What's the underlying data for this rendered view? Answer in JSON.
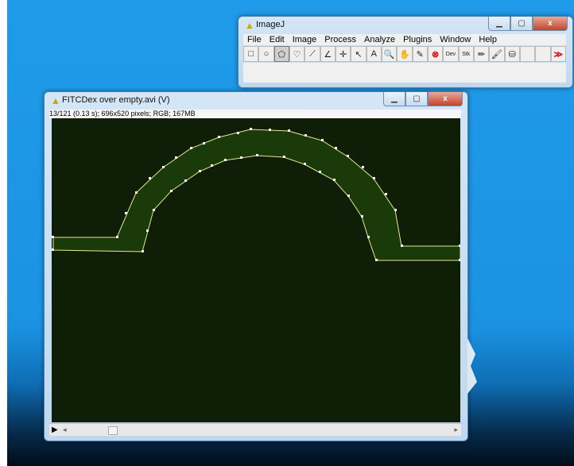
{
  "imagej_window": {
    "title": "ImageJ",
    "menu": [
      "File",
      "Edit",
      "Image",
      "Process",
      "Analyze",
      "Plugins",
      "Window",
      "Help"
    ],
    "tools": [
      {
        "name": "rectangle-tool-icon",
        "glyph": "□"
      },
      {
        "name": "oval-tool-icon",
        "glyph": "○"
      },
      {
        "name": "polygon-tool-icon",
        "glyph": "⬠"
      },
      {
        "name": "freehand-tool-icon",
        "glyph": "♡"
      },
      {
        "name": "line-tool-icon",
        "glyph": "⟋"
      },
      {
        "name": "angle-tool-icon",
        "glyph": "∠"
      },
      {
        "name": "point-tool-icon",
        "glyph": "✛"
      },
      {
        "name": "wand-tool-icon",
        "glyph": "↖"
      },
      {
        "name": "text-tool-icon",
        "glyph": "A"
      },
      {
        "name": "magnifier-tool-icon",
        "glyph": "🔍"
      },
      {
        "name": "hand-tool-icon",
        "glyph": "✋"
      },
      {
        "name": "color-picker-icon",
        "glyph": "✎"
      },
      {
        "name": "stop-icon",
        "glyph": "⊗"
      },
      {
        "name": "dev-menu-icon",
        "glyph": "Dev"
      },
      {
        "name": "stk-menu-icon",
        "glyph": "Stk"
      },
      {
        "name": "pencil-tool-icon",
        "glyph": "✏"
      },
      {
        "name": "brush-tool-icon",
        "glyph": "🖌"
      },
      {
        "name": "flood-fill-tool-icon",
        "glyph": "⛁"
      },
      {
        "name": "more-tools-icon",
        "glyph": "≫"
      }
    ]
  },
  "image_window": {
    "title": "FITCDex over empty.avi (V)",
    "info": "13/121 (0.13 s); 696x520 pixels; RGB; 167MB"
  },
  "colors": {
    "desktop": "#1f9be9",
    "canvas_bg": "#0f1e06",
    "roi_fill": "#1b3a0a",
    "roi_line": "#e6e68a"
  }
}
